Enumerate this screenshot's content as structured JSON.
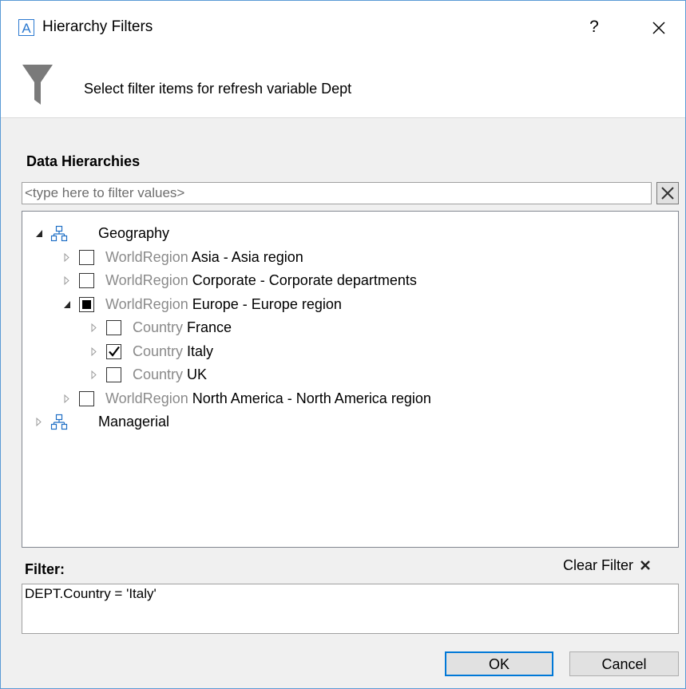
{
  "window": {
    "title": "Hierarchy Filters",
    "app_icon_letter": "A",
    "help_label": "?",
    "accent_color": "#0078d7"
  },
  "header": {
    "description": "Select filter items for refresh variable Dept"
  },
  "hierarchies": {
    "label": "Data Hierarchies",
    "search_placeholder": "<type here to filter values>",
    "search_value": ""
  },
  "tree": {
    "nodes": [
      {
        "level": 0,
        "expanded": true,
        "icon": "hierarchy-icon",
        "text": "Geography"
      },
      {
        "level": 1,
        "expanded": false,
        "state": "unchecked",
        "level_label": "WorldRegion",
        "text": "Asia - Asia region"
      },
      {
        "level": 1,
        "expanded": false,
        "state": "unchecked",
        "level_label": "WorldRegion",
        "text": "Corporate - Corporate departments"
      },
      {
        "level": 1,
        "expanded": true,
        "state": "partial",
        "level_label": "WorldRegion",
        "text": "Europe - Europe region"
      },
      {
        "level": 2,
        "expanded": false,
        "state": "unchecked",
        "level_label": "Country",
        "text": "France"
      },
      {
        "level": 2,
        "expanded": false,
        "state": "checked",
        "level_label": "Country",
        "text": "Italy"
      },
      {
        "level": 2,
        "expanded": false,
        "state": "unchecked",
        "level_label": "Country",
        "text": "UK"
      },
      {
        "level": 1,
        "expanded": false,
        "state": "unchecked",
        "level_label": "WorldRegion",
        "text": "North America - North America region"
      },
      {
        "level": 0,
        "expanded": false,
        "icon": "hierarchy-icon",
        "text": "Managerial"
      }
    ]
  },
  "filter": {
    "label": "Filter:",
    "clear_label": "Clear Filter",
    "expression": "DEPT.Country = 'Italy'"
  },
  "buttons": {
    "ok": "OK",
    "cancel": "Cancel"
  }
}
